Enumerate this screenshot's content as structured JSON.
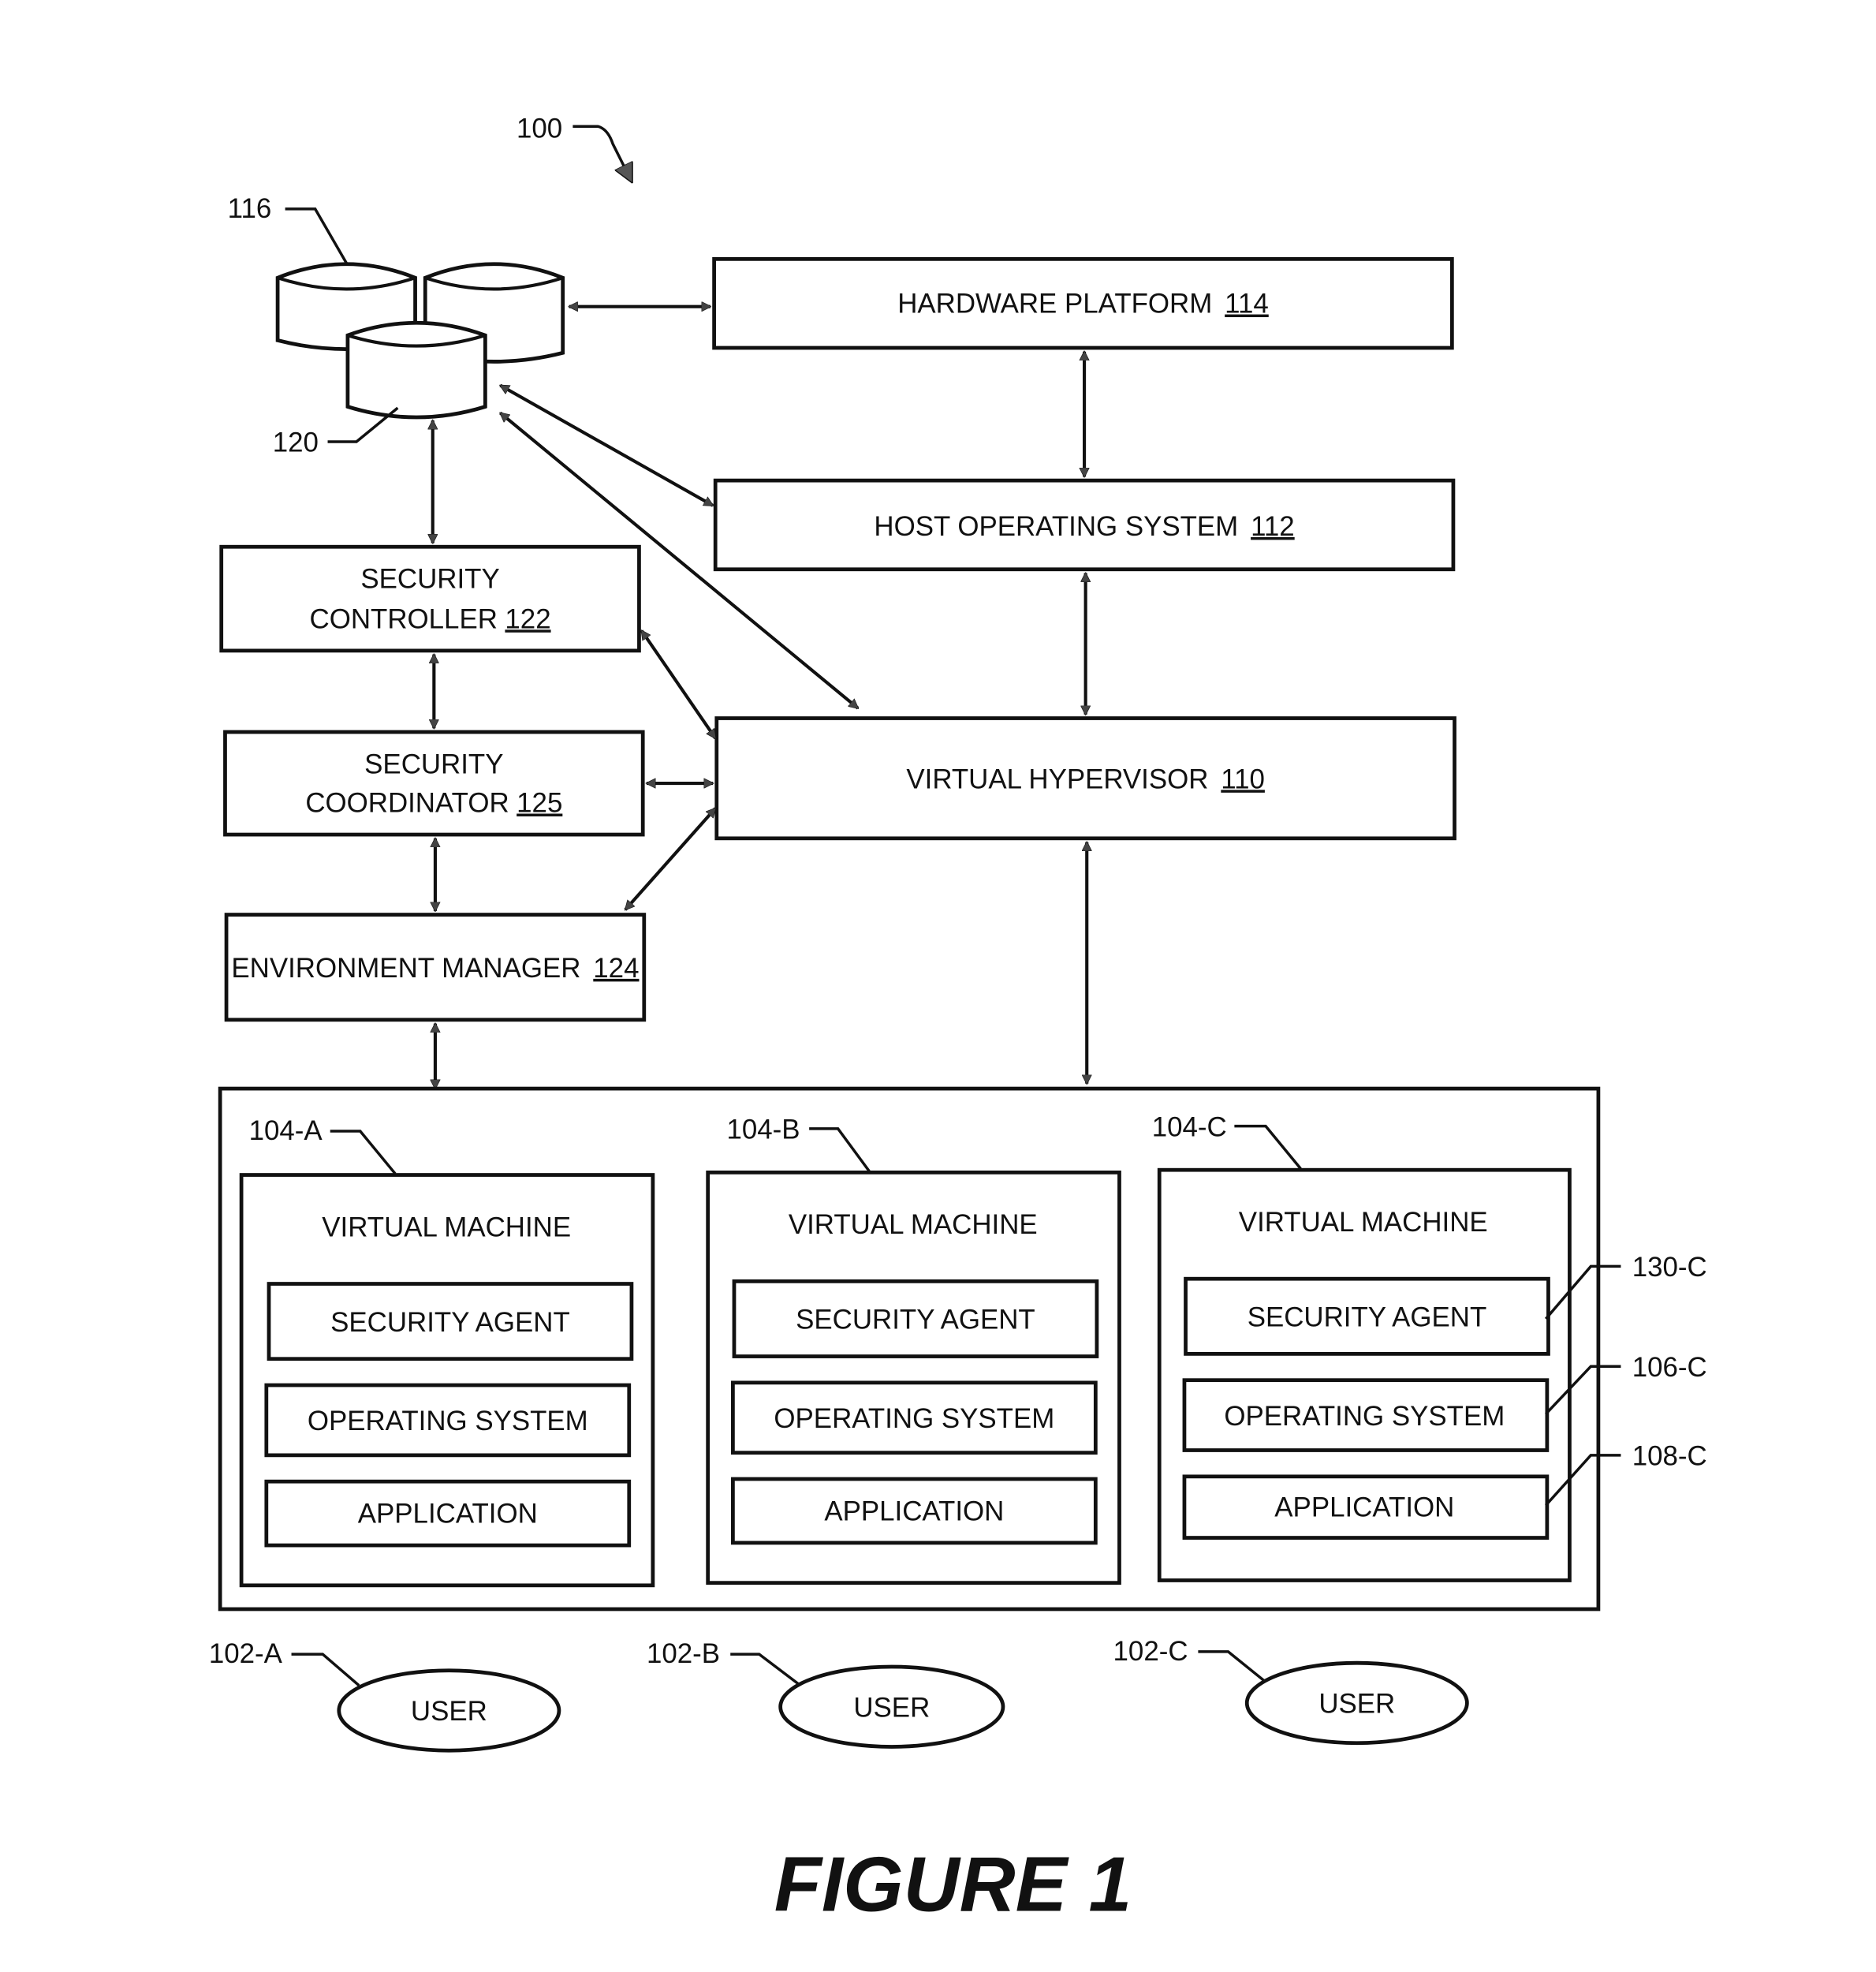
{
  "figure": {
    "ref_system": "100",
    "caption": "FIGURE 1",
    "storage": {
      "ref_group": "116",
      "ref_item": "120"
    },
    "hardware_platform": {
      "label": "HARDWARE PLATFORM",
      "ref": "114"
    },
    "host_os": {
      "label": "HOST OPERATING SYSTEM",
      "ref": "112"
    },
    "hypervisor": {
      "label": "VIRTUAL HYPERVISOR",
      "ref": "110"
    },
    "security_controller": {
      "line1": "SECURITY",
      "line2": "CONTROLLER",
      "ref": "122"
    },
    "security_coordinator": {
      "line1": "SECURITY",
      "line2": "COORDINATOR",
      "ref": "125"
    },
    "environment_manager": {
      "label": "ENVIRONMENT MANAGER",
      "ref": "124"
    },
    "vms": [
      {
        "ref": "104-A",
        "title": "VIRTUAL MACHINE",
        "layers": [
          "SECURITY AGENT",
          "OPERATING SYSTEM",
          "APPLICATION"
        ]
      },
      {
        "ref": "104-B",
        "title": "VIRTUAL MACHINE",
        "layers": [
          "SECURITY AGENT",
          "OPERATING SYSTEM",
          "APPLICATION"
        ]
      },
      {
        "ref": "104-C",
        "title": "VIRTUAL MACHINE",
        "layers": [
          "SECURITY AGENT",
          "OPERATING SYSTEM",
          "APPLICATION"
        ],
        "layer_refs": [
          "130-C",
          "106-C",
          "108-C"
        ]
      }
    ],
    "users": [
      {
        "ref": "102-A",
        "label": "USER"
      },
      {
        "ref": "102-B",
        "label": "USER"
      },
      {
        "ref": "102-C",
        "label": "USER"
      }
    ]
  }
}
